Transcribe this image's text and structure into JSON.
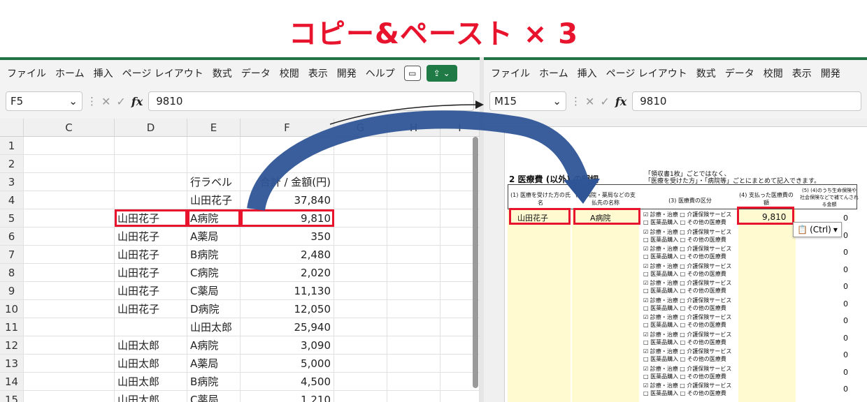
{
  "title": "コピー&ペースト × 3",
  "left": {
    "ribbon": [
      "ファイル",
      "ホーム",
      "挿入",
      "ページ レイアウト",
      "数式",
      "データ",
      "校閲",
      "表示",
      "開発",
      "ヘルプ"
    ],
    "namebox": "F5",
    "formula": "9810",
    "columns": [
      "C",
      "D",
      "E",
      "F",
      "G",
      "H",
      "I"
    ],
    "rows": [
      {
        "n": "1",
        "D": "",
        "E": "",
        "F": ""
      },
      {
        "n": "2",
        "D": "",
        "E": "",
        "F": ""
      },
      {
        "n": "3",
        "D": "",
        "E": "行ラベル",
        "F": "合計 / 金額(円)"
      },
      {
        "n": "4",
        "D": "",
        "E": "山田花子",
        "F": "37,840"
      },
      {
        "n": "5",
        "D": "山田花子",
        "E": "A病院",
        "F": "9,810"
      },
      {
        "n": "6",
        "D": "山田花子",
        "E": "A薬局",
        "F": "350"
      },
      {
        "n": "7",
        "D": "山田花子",
        "E": "B病院",
        "F": "2,480"
      },
      {
        "n": "8",
        "D": "山田花子",
        "E": "C病院",
        "F": "2,020"
      },
      {
        "n": "9",
        "D": "山田花子",
        "E": "C薬局",
        "F": "11,130"
      },
      {
        "n": "10",
        "D": "山田花子",
        "E": "D病院",
        "F": "12,050"
      },
      {
        "n": "11",
        "D": "",
        "E": "山田太郎",
        "F": "25,940"
      },
      {
        "n": "12",
        "D": "山田太郎",
        "E": "A病院",
        "F": "3,090"
      },
      {
        "n": "13",
        "D": "山田太郎",
        "E": "A薬局",
        "F": "5,000"
      },
      {
        "n": "14",
        "D": "山田太郎",
        "E": "B病院",
        "F": "4,500"
      },
      {
        "n": "15",
        "D": "山田太郎",
        "E": "C薬局",
        "F": "1,210"
      }
    ]
  },
  "right": {
    "ribbon": [
      "ファイル",
      "ホーム",
      "挿入",
      "ページ レイアウト",
      "数式",
      "データ",
      "校閲",
      "表示",
      "開発"
    ],
    "namebox": "M15",
    "formula": "9810",
    "section_title": "2 医療費 (以外) の明細",
    "note1": "「領収書1枚」ごとではなく、",
    "note2": "「医療を受けた方」・「病院等」ごとにまとめて記入できます。",
    "h_col1": "(1) 医療を受けた方の氏名",
    "h_col2": "(2) 病院・薬局などの支払先の名称",
    "h_col3": "(3) 医療費の区分",
    "h_col4": "(4) 支払った医療費の額",
    "h_col5": "(5) (4)のうち生命保険や社会保険などで補てんされる金額",
    "pasted_name": "山田花子",
    "pasted_place": "A病院",
    "pasted_amount": "9,810",
    "yen": "円",
    "zero": "0",
    "cat_a1": "☑ 診療・治療 □ 介護保険サービス",
    "cat_a2": "□ 医薬品購入 □ その他の医療費",
    "ctrl_label": "(Ctrl)"
  }
}
